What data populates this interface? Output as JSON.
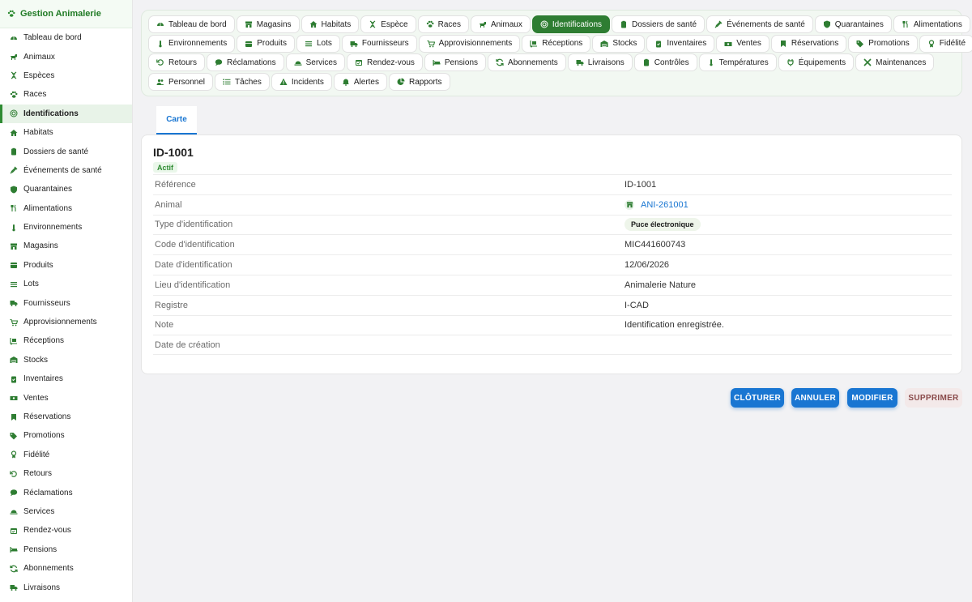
{
  "app": {
    "title": "Gestion Animalerie",
    "icon": "paw-icon"
  },
  "sidebar": {
    "items": [
      {
        "label": "Tableau de bord",
        "icon": "gauge-icon",
        "active": false
      },
      {
        "label": "Animaux",
        "icon": "dog-icon",
        "active": false
      },
      {
        "label": "Espèces",
        "icon": "dna-icon",
        "active": false
      },
      {
        "label": "Races",
        "icon": "paw-icon",
        "active": false
      },
      {
        "label": "Identifications",
        "icon": "fingerprint-icon",
        "active": true
      },
      {
        "label": "Habitats",
        "icon": "house-icon",
        "active": false
      },
      {
        "label": "Dossiers de santé",
        "icon": "clipboard-icon",
        "active": false
      },
      {
        "label": "Événements de santé",
        "icon": "syringe-icon",
        "active": false
      },
      {
        "label": "Quarantaines",
        "icon": "shield-icon",
        "active": false
      },
      {
        "label": "Alimentations",
        "icon": "utensils-icon",
        "active": false
      },
      {
        "label": "Environnements",
        "icon": "thermometer-icon",
        "active": false
      },
      {
        "label": "Magasins",
        "icon": "store-icon",
        "active": false
      },
      {
        "label": "Produits",
        "icon": "box-icon",
        "active": false
      },
      {
        "label": "Lots",
        "icon": "list-icon",
        "active": false
      },
      {
        "label": "Fournisseurs",
        "icon": "truck-icon",
        "active": false
      },
      {
        "label": "Approvisionnements",
        "icon": "cart-icon",
        "active": false
      },
      {
        "label": "Réceptions",
        "icon": "dolly-icon",
        "active": false
      },
      {
        "label": "Stocks",
        "icon": "warehouse-icon",
        "active": false
      },
      {
        "label": "Inventaires",
        "icon": "clipboard-check-icon",
        "active": false
      },
      {
        "label": "Ventes",
        "icon": "cash-icon",
        "active": false
      },
      {
        "label": "Réservations",
        "icon": "bookmark-icon",
        "active": false
      },
      {
        "label": "Promotions",
        "icon": "tags-icon",
        "active": false
      },
      {
        "label": "Fidélité",
        "icon": "award-icon",
        "active": false
      },
      {
        "label": "Retours",
        "icon": "undo-icon",
        "active": false
      },
      {
        "label": "Réclamations",
        "icon": "comment-icon",
        "active": false
      },
      {
        "label": "Services",
        "icon": "bell-concierge-icon",
        "active": false
      },
      {
        "label": "Rendez-vous",
        "icon": "calendar-icon",
        "active": false
      },
      {
        "label": "Pensions",
        "icon": "bed-icon",
        "active": false
      },
      {
        "label": "Abonnements",
        "icon": "sync-icon",
        "active": false
      },
      {
        "label": "Livraisons",
        "icon": "truck-icon",
        "active": false
      }
    ]
  },
  "topnav": {
    "rows": [
      [
        {
          "label": "Tableau de bord",
          "icon": "gauge-icon",
          "active": false
        },
        {
          "label": "Magasins",
          "icon": "store-icon",
          "active": false
        },
        {
          "label": "Habitats",
          "icon": "house-icon",
          "active": false
        },
        {
          "label": "Espèce",
          "icon": "dna-icon",
          "active": false
        },
        {
          "label": "Races",
          "icon": "paw-icon",
          "active": false
        },
        {
          "label": "Animaux",
          "icon": "dog-icon",
          "active": false
        },
        {
          "label": "Identifications",
          "icon": "fingerprint-icon",
          "active": true
        },
        {
          "label": "Dossiers de santé",
          "icon": "clipboard-icon",
          "active": false
        },
        {
          "label": "Événements de santé",
          "icon": "syringe-icon",
          "active": false
        },
        {
          "label": "Quarantaines",
          "icon": "shield-icon",
          "active": false
        },
        {
          "label": "Alimentations",
          "icon": "utensils-icon",
          "active": false
        }
      ],
      [
        {
          "label": "Environnements",
          "icon": "thermometer-icon",
          "active": false
        },
        {
          "label": "Produits",
          "icon": "box-icon",
          "active": false
        },
        {
          "label": "Lots",
          "icon": "list-icon",
          "active": false
        },
        {
          "label": "Fournisseurs",
          "icon": "truck-icon",
          "active": false
        },
        {
          "label": "Approvisionnements",
          "icon": "cart-icon",
          "active": false
        },
        {
          "label": "Réceptions",
          "icon": "dolly-icon",
          "active": false
        },
        {
          "label": "Stocks",
          "icon": "warehouse-icon",
          "active": false
        },
        {
          "label": "Inventaires",
          "icon": "clipboard-check-icon",
          "active": false
        },
        {
          "label": "Ventes",
          "icon": "cash-icon",
          "active": false
        },
        {
          "label": "Réservations",
          "icon": "bookmark-icon",
          "active": false
        },
        {
          "label": "Promotions",
          "icon": "tags-icon",
          "active": false
        },
        {
          "label": "Fidélité",
          "icon": "award-icon",
          "active": false
        }
      ],
      [
        {
          "label": "Retours",
          "icon": "undo-icon",
          "active": false
        },
        {
          "label": "Réclamations",
          "icon": "comment-icon",
          "active": false
        },
        {
          "label": "Services",
          "icon": "bell-concierge-icon",
          "active": false
        },
        {
          "label": "Rendez-vous",
          "icon": "calendar-icon",
          "active": false
        },
        {
          "label": "Pensions",
          "icon": "bed-icon",
          "active": false
        },
        {
          "label": "Abonnements",
          "icon": "sync-icon",
          "active": false
        },
        {
          "label": "Livraisons",
          "icon": "truck-icon",
          "active": false
        },
        {
          "label": "Contrôles",
          "icon": "clipboard-icon",
          "active": false
        },
        {
          "label": "Températures",
          "icon": "thermometer-icon",
          "active": false
        },
        {
          "label": "Équipements",
          "icon": "plug-icon",
          "active": false
        },
        {
          "label": "Maintenances",
          "icon": "tools-icon",
          "active": false
        }
      ],
      [
        {
          "label": "Personnel",
          "icon": "users-icon",
          "active": false
        },
        {
          "label": "Tâches",
          "icon": "tasks-icon",
          "active": false
        },
        {
          "label": "Incidents",
          "icon": "warning-icon",
          "active": false
        },
        {
          "label": "Alertes",
          "icon": "bell-icon",
          "active": false
        },
        {
          "label": "Rapports",
          "icon": "chart-pie-icon",
          "active": false
        }
      ]
    ]
  },
  "tabs": [
    {
      "label": "Carte",
      "active": true
    }
  ],
  "record": {
    "title": "ID-1001",
    "status": "Actif",
    "fields": [
      {
        "label": "Référence",
        "value": "ID-1001",
        "type": "text"
      },
      {
        "label": "Animal",
        "value": "ANI-261001",
        "type": "link",
        "icon": "store-icon"
      },
      {
        "label": "Type d'identification",
        "value": "Puce électronique",
        "type": "pill"
      },
      {
        "label": "Code d'identification",
        "value": "MIC441600743",
        "type": "text"
      },
      {
        "label": "Date d'identification",
        "value": "12/06/2026",
        "type": "text"
      },
      {
        "label": "Lieu d'identification",
        "value": "Animalerie Nature",
        "type": "text"
      },
      {
        "label": "Registre",
        "value": "I-CAD",
        "type": "text"
      },
      {
        "label": "Note",
        "value": "Identification enregistrée.",
        "type": "text"
      },
      {
        "label": "Date de création",
        "value": "",
        "type": "text"
      }
    ]
  },
  "actions": {
    "close": "CLÔTURER",
    "cancel": "ANNULER",
    "edit": "MODIFIER",
    "delete": "SUPPRIMER"
  },
  "colors": {
    "accent_green": "#2e7d32",
    "accent_blue": "#1976d2",
    "danger_bg": "#f3e9e9"
  }
}
